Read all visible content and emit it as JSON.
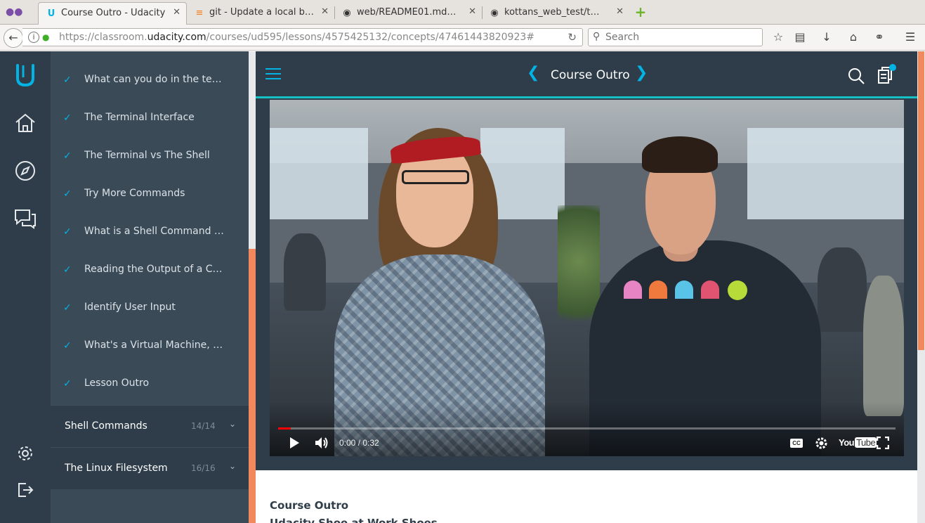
{
  "browser": {
    "tabs": [
      {
        "title": "Course Outro - Udacity",
        "icon": "udacity-icon",
        "active": true
      },
      {
        "title": "git - Update a local b…",
        "icon": "stackoverflow-icon",
        "active": false
      },
      {
        "title": "web/README01.md…",
        "icon": "github-icon",
        "active": false
      },
      {
        "title": "kottans_web_test/t…",
        "icon": "github-icon",
        "active": false
      }
    ],
    "url_prefix": "https://classroom.",
    "url_domain": "udacity.com",
    "url_path": "/courses/ud595/lessons/4575425132/concepts/47461443820923#",
    "search_placeholder": "Search"
  },
  "sidebar": {
    "concepts": [
      {
        "label": "What can you do in the terminal?",
        "done": true
      },
      {
        "label": "The Terminal Interface",
        "done": true
      },
      {
        "label": "The Terminal vs The Shell",
        "done": true
      },
      {
        "label": "Try More Commands",
        "done": true
      },
      {
        "label": "What is a Shell Command …",
        "done": true
      },
      {
        "label": "Reading the Output of a Command",
        "done": true
      },
      {
        "label": "Identify User Input",
        "done": true
      },
      {
        "label": "What's a Virtual Machine, really?",
        "done": true
      },
      {
        "label": "Lesson Outro",
        "done": true
      }
    ],
    "lessons": [
      {
        "name": "Shell Commands",
        "count": "14/14"
      },
      {
        "name": "The Linux Filesystem",
        "count": "16/16"
      }
    ]
  },
  "header": {
    "title": "Course Outro"
  },
  "video": {
    "time": "0:00 / 0:32",
    "progress": 0.02,
    "cc_label": "CC",
    "youtube_label": "You",
    "youtube_tube": "Tube"
  },
  "content": {
    "title": "Course Outro",
    "subtitle": "Udacity Shoe at Work Shoes"
  },
  "colors": {
    "rail": "#2e3d49",
    "sidebar": "#3a4a57",
    "accent": "#02b3e4",
    "check": "#02b3e4",
    "scroll": "#f2895c",
    "topbar_border": "#15c1c2"
  }
}
